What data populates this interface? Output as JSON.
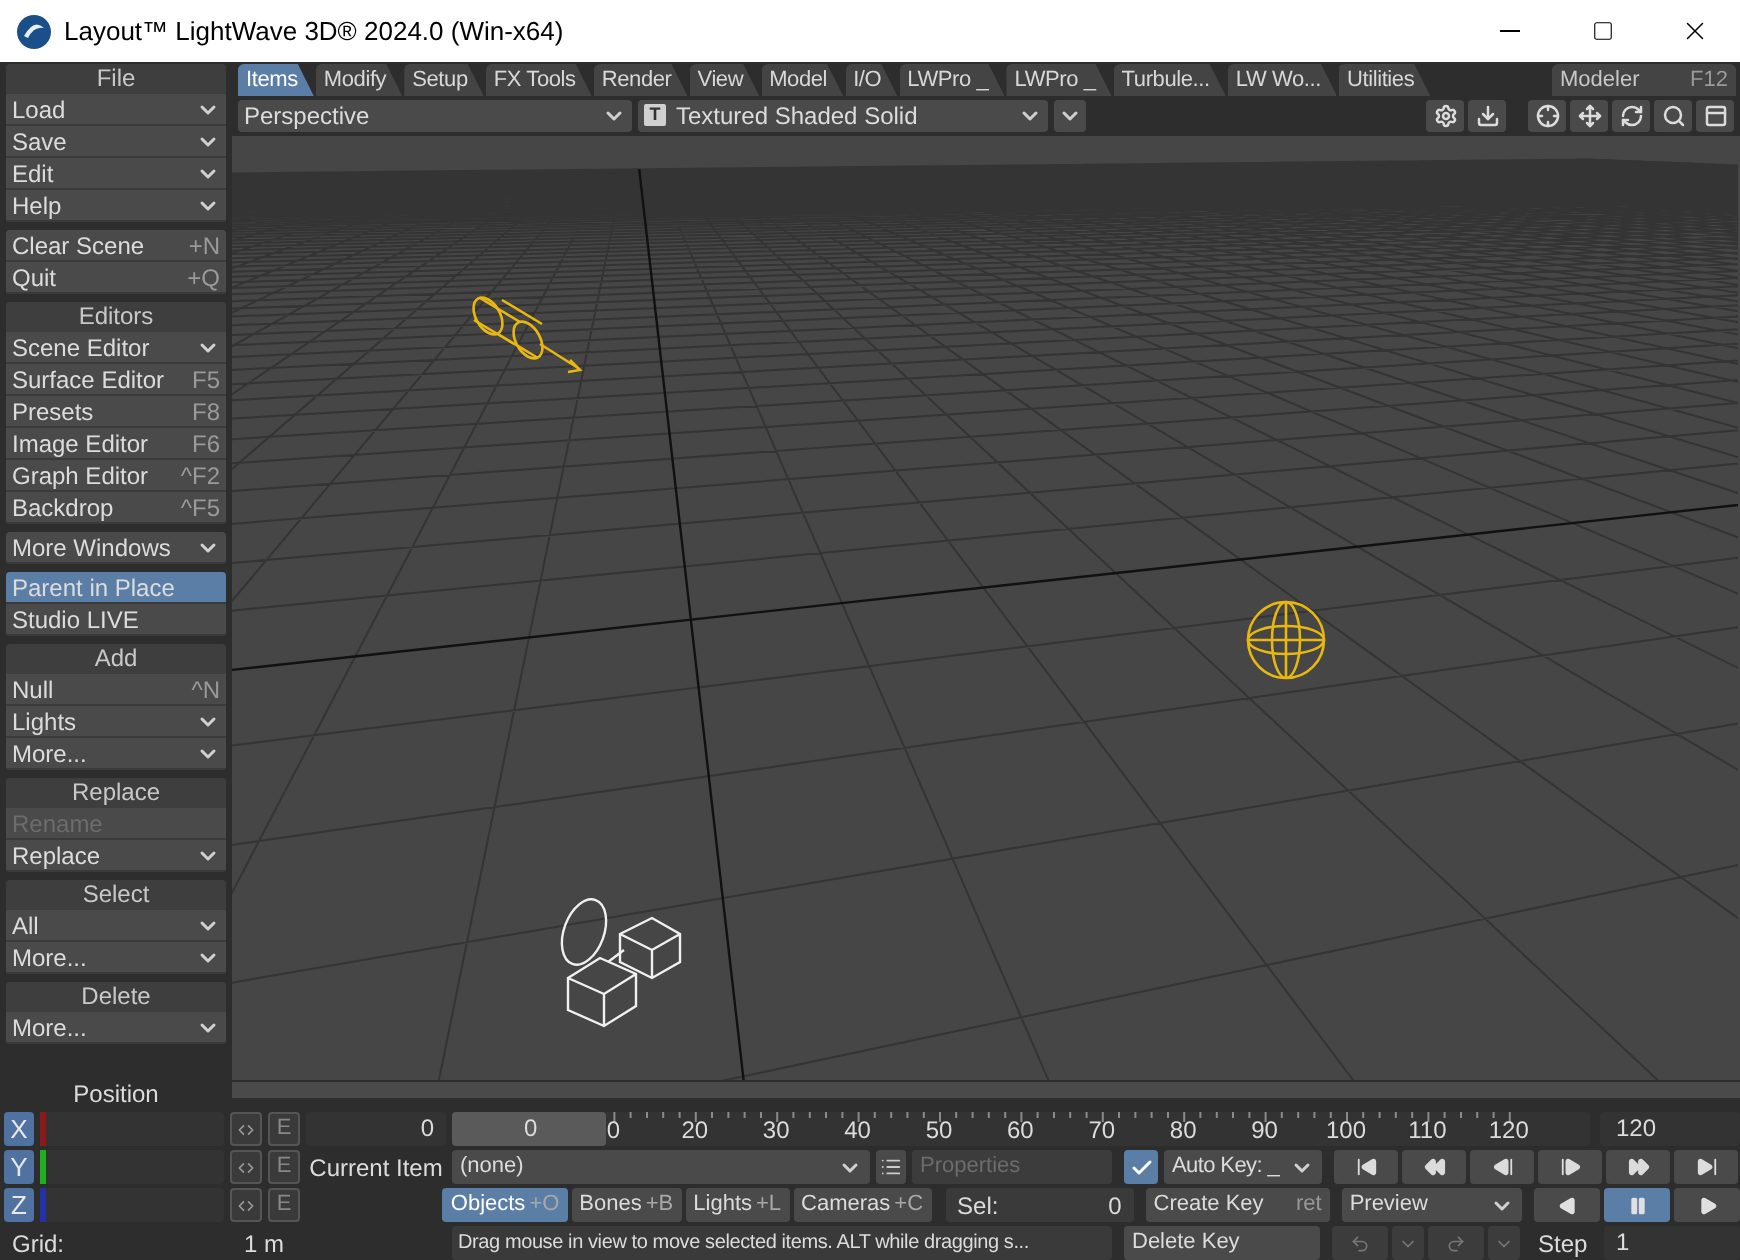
{
  "window": {
    "title": "Layout™ LightWave 3D® 2024.0 (Win-x64)"
  },
  "sidebar": {
    "groups": [
      {
        "title": "File",
        "items": [
          {
            "label": "Load",
            "kind": "menu"
          },
          {
            "label": "Save",
            "kind": "menu"
          },
          {
            "label": "Edit",
            "kind": "menu"
          },
          {
            "label": "Help",
            "kind": "menu"
          }
        ]
      },
      {
        "items": [
          {
            "label": "Clear Scene",
            "kind": "command",
            "shortcut": "+N"
          },
          {
            "label": "Quit",
            "kind": "command",
            "shortcut": "+Q"
          }
        ]
      },
      {
        "title": "Editors",
        "items": [
          {
            "label": "Scene Editor",
            "kind": "menu"
          },
          {
            "label": "Surface Editor",
            "kind": "command",
            "shortcut": "F5"
          },
          {
            "label": "Presets",
            "kind": "command",
            "shortcut": "F8"
          },
          {
            "label": "Image Editor",
            "kind": "command",
            "shortcut": "F6"
          },
          {
            "label": "Graph Editor",
            "kind": "command",
            "shortcut": "^F2"
          },
          {
            "label": "Backdrop",
            "kind": "command",
            "shortcut": "^F5"
          }
        ]
      },
      {
        "items": [
          {
            "label": "More Windows",
            "kind": "menu"
          }
        ]
      },
      {
        "items": [
          {
            "label": "Parent in Place",
            "kind": "command",
            "on": true
          },
          {
            "label": "Studio LIVE",
            "kind": "command",
            "on": false
          }
        ]
      },
      {
        "title": "Add",
        "items": [
          {
            "label": "Null",
            "kind": "command",
            "shortcut": "^N"
          },
          {
            "label": "Lights",
            "kind": "menu"
          },
          {
            "label": "More...",
            "kind": "menu"
          }
        ]
      },
      {
        "title": "Replace",
        "items": [
          {
            "label": "Rename",
            "kind": "command",
            "disabled": true
          },
          {
            "label": "Replace",
            "kind": "menu",
            "disabled": false
          }
        ]
      },
      {
        "title": "Select",
        "items": [
          {
            "label": "All",
            "kind": "menu"
          },
          {
            "label": "More...",
            "kind": "menu"
          }
        ]
      },
      {
        "title": "Delete",
        "items": [
          {
            "label": "More...",
            "kind": "menu"
          }
        ]
      }
    ]
  },
  "tabs": [
    {
      "label": "Items",
      "selected": true
    },
    {
      "label": "Modify",
      "selected": false
    },
    {
      "label": "Setup",
      "selected": false
    },
    {
      "label": "FX Tools",
      "selected": false
    },
    {
      "label": "Render",
      "selected": false
    },
    {
      "label": "View",
      "selected": false
    },
    {
      "label": "Model",
      "selected": false
    },
    {
      "label": "I/O",
      "selected": false
    },
    {
      "label": "LWPro _",
      "selected": false
    },
    {
      "label": "LWPro _",
      "selected": false
    },
    {
      "label": "Turbule...",
      "selected": false
    },
    {
      "label": "LW Wo...",
      "selected": false
    },
    {
      "label": "Utilities",
      "selected": false
    }
  ],
  "modeler_tab": {
    "label": "Modeler",
    "shortcut": "F12"
  },
  "viewport_bar": {
    "view": "Perspective",
    "shading_icon": "T",
    "shading": "Textured Shaded Solid"
  },
  "position": {
    "title": "Position",
    "axes": [
      {
        "label": "X",
        "color": "#8b1a1a",
        "edit": "E"
      },
      {
        "label": "Y",
        "color": "#1fae1f",
        "edit": "E"
      },
      {
        "label": "Z",
        "color": "#2233aa",
        "edit": "E"
      }
    ]
  },
  "grid": {
    "label": "Grid:",
    "value": "1 m"
  },
  "timeline": {
    "current_frame": "0",
    "thumb": "0",
    "level": 0,
    "ticks": [
      "0",
      "20",
      "30",
      "40",
      "50",
      "60",
      "70",
      "80",
      "90",
      "100",
      "110",
      "120"
    ],
    "end_frame": "120"
  },
  "current_item": {
    "label": "Current Item",
    "value": "(none)",
    "properties": "Properties",
    "disabled": true
  },
  "item_types": [
    {
      "label": "Objects",
      "shortcut": "+O",
      "selected": true
    },
    {
      "label": "Bones",
      "shortcut": "+B",
      "selected": false
    },
    {
      "label": "Lights",
      "shortcut": "+L",
      "selected": false
    },
    {
      "label": "Cameras",
      "shortcut": "+C",
      "selected": false
    }
  ],
  "selection": {
    "label": "Sel:",
    "value": "0"
  },
  "auto_key": {
    "checked": true,
    "label": "Auto Key: _"
  },
  "keys": {
    "create": "Create Key",
    "create_shortcut": "ret",
    "delete": "Delete Key"
  },
  "preview": "Preview",
  "transport": [
    {
      "kind": "first"
    },
    {
      "kind": "prev_key"
    },
    {
      "kind": "step_back"
    },
    {
      "kind": "step_forward"
    },
    {
      "kind": "next_key"
    },
    {
      "kind": "last"
    }
  ],
  "playback": [
    {
      "kind": "back",
      "selected": false
    },
    {
      "kind": "pause",
      "selected": true
    },
    {
      "kind": "play",
      "selected": false
    }
  ],
  "step": {
    "label": "Step",
    "value": "1"
  },
  "status": "Drag mouse in view to move selected items. ALT while dragging s..."
}
